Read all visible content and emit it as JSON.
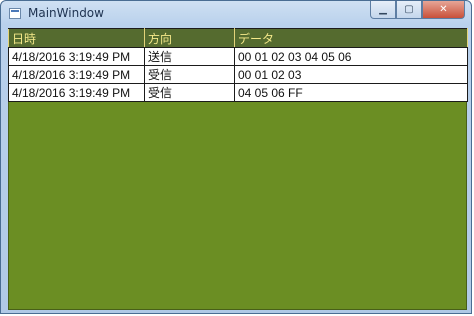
{
  "window": {
    "title": "MainWindow"
  },
  "caption_buttons": {
    "minimize": "▁",
    "maximize": "▢",
    "close": "✕"
  },
  "grid": {
    "headers": [
      "日時",
      "方向",
      "データ"
    ],
    "rows": [
      [
        "4/18/2016 3:19:49 PM",
        "送信",
        "00 01 02 03 04 05 06"
      ],
      [
        "4/18/2016 3:19:49 PM",
        "受信",
        "00 01 02 03"
      ],
      [
        "4/18/2016 3:19:49 PM",
        "受信",
        "04 05 06 FF"
      ]
    ]
  },
  "colors": {
    "background": "#6b8e23",
    "header_background": "#556b2f",
    "header_text": "#f5e98a"
  }
}
